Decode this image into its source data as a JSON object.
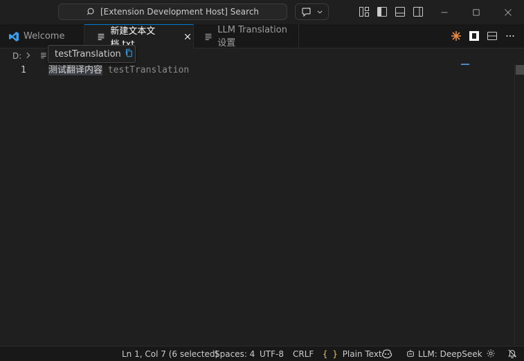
{
  "titlebar": {
    "search_text": "[Extension Development Host] Search"
  },
  "tabs": [
    {
      "label": "Welcome",
      "active": false
    },
    {
      "label": "新建文本文档.txt",
      "active": true
    },
    {
      "label": "LLM Translation 设置",
      "active": false
    }
  ],
  "breadcrumb": {
    "drive": "D:"
  },
  "tooltip": {
    "text": "testTranslation"
  },
  "editor": {
    "line_number": "1",
    "selected_text": "测试翻译内容",
    "ghost_text": " testTranslation"
  },
  "statusbar": {
    "position": "Ln 1, Col 7 (6 selected)",
    "spaces": "Spaces: 4",
    "encoding": "UTF-8",
    "eol": "CRLF",
    "language": "Plain Text",
    "llm": "LLM: DeepSeek"
  },
  "colors": {
    "accent": "#0078d4",
    "vscode_blue": "#3b9eea",
    "copilot_orange": "#e88b45"
  }
}
